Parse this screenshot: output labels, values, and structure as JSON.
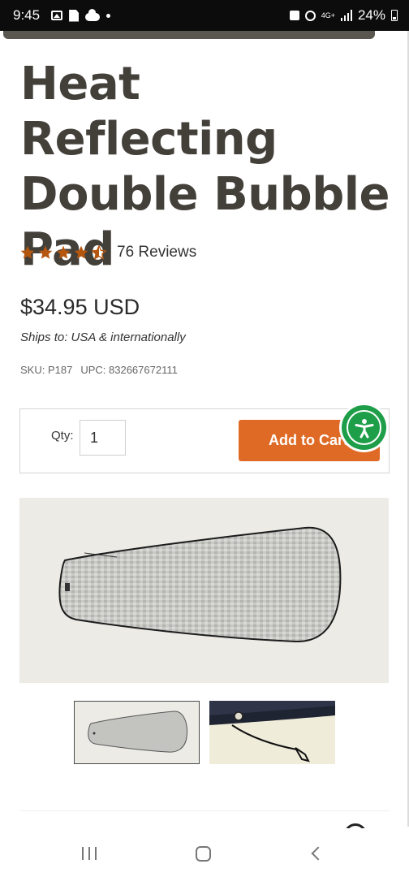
{
  "status_bar": {
    "time": "9:45",
    "network": "4G+",
    "battery": "24%"
  },
  "product": {
    "title": "Heat Reflecting Double Bubble Pad",
    "rating": 4.5,
    "rating_max": 5,
    "reviews": "76 Reviews",
    "price": "$34.95 USD",
    "ships": "Ships to: USA & internationally",
    "sku": "SKU: P187",
    "upc": "UPC: 832667672111"
  },
  "cart": {
    "qty_label": "Qty:",
    "qty_value": "1",
    "add_to_cart": "Add to Cart"
  },
  "colors": {
    "title": "#433f39",
    "star": "#b5560f",
    "accent": "#df6a26",
    "accessibility": "#1e9e48"
  },
  "icons": {
    "accessibility": "accessibility-icon",
    "star": "star-icon",
    "description_toggle": "chevron-toggle-icon"
  }
}
